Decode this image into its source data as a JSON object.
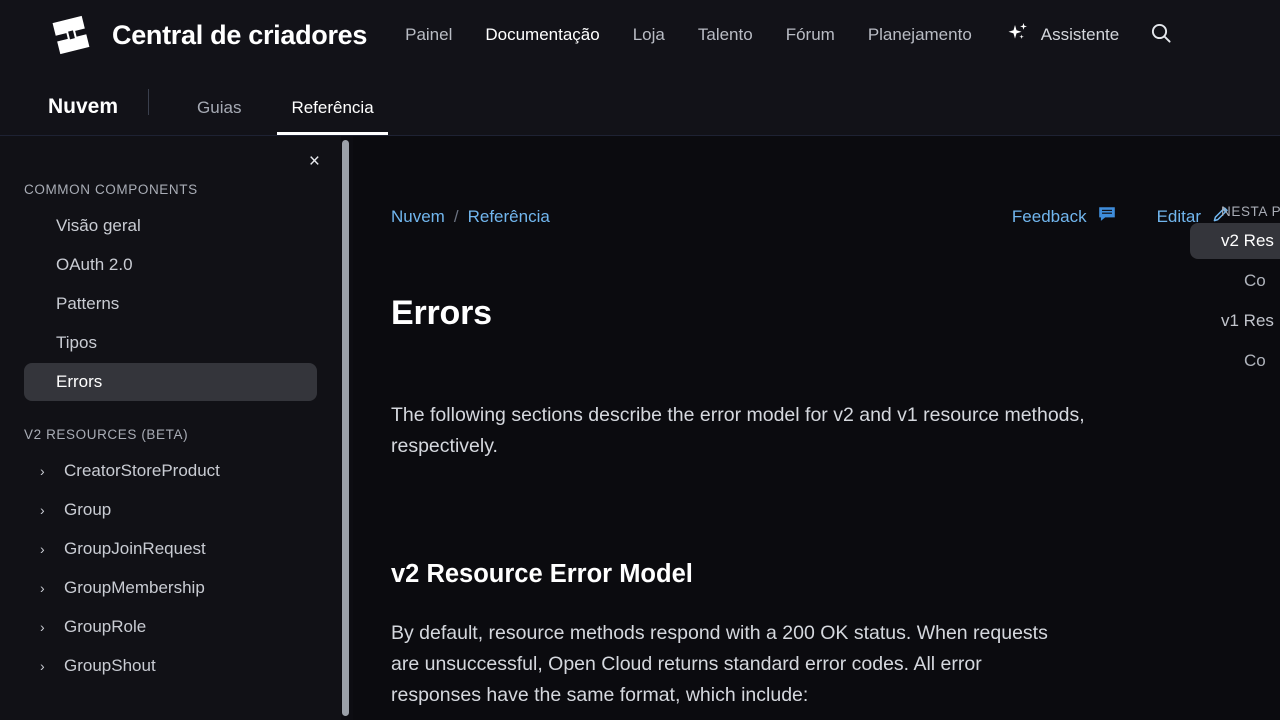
{
  "colors": {
    "page_bg": "#0b0b0f",
    "header_bg": "#121218",
    "sidebar_bg": "#111116",
    "active_pill": "#34353b",
    "link_blue": "#71b6ee",
    "body_text": "#d5d8de"
  },
  "header": {
    "logo_icon": "roblox-logo-icon",
    "brand_title": "Central de criadores",
    "nav": [
      {
        "label": "Painel",
        "active": false
      },
      {
        "label": "Documentação",
        "active": true
      },
      {
        "label": "Loja",
        "active": false
      },
      {
        "label": "Talento",
        "active": false
      },
      {
        "label": "Fórum",
        "active": false
      },
      {
        "label": "Planejamento",
        "active": false
      }
    ],
    "assistant_label": "Assistente",
    "assistant_icon": "sparkles-icon",
    "search_icon": "search-icon"
  },
  "tabbar": {
    "product": "Nuvem",
    "tabs": [
      {
        "label": "Guias",
        "active": false
      },
      {
        "label": "Referência",
        "active": true
      }
    ]
  },
  "sidebar": {
    "close_icon": "close-icon",
    "close_label": "×",
    "sections": [
      {
        "title": "COMMON COMPONENTS",
        "items": [
          {
            "label": "Visão geral",
            "active": false,
            "tree": false
          },
          {
            "label": "OAuth 2.0",
            "active": false,
            "tree": false
          },
          {
            "label": "Patterns",
            "active": false,
            "tree": false
          },
          {
            "label": "Tipos",
            "active": false,
            "tree": false
          },
          {
            "label": "Errors",
            "active": true,
            "tree": false
          }
        ]
      },
      {
        "title": "V2 RESOURCES (BETA)",
        "items": [
          {
            "label": "CreatorStoreProduct",
            "active": false,
            "tree": true
          },
          {
            "label": "Group",
            "active": false,
            "tree": true
          },
          {
            "label": "GroupJoinRequest",
            "active": false,
            "tree": true
          },
          {
            "label": "GroupMembership",
            "active": false,
            "tree": true
          },
          {
            "label": "GroupRole",
            "active": false,
            "tree": true
          },
          {
            "label": "GroupShout",
            "active": false,
            "tree": true
          }
        ]
      }
    ],
    "chevron_icon": "chevron-right-icon"
  },
  "main": {
    "breadcrumb": [
      {
        "label": "Nuvem"
      },
      {
        "label": "Referência"
      }
    ],
    "breadcrumb_separator": "/",
    "feedback_label": "Feedback",
    "feedback_icon": "comment-icon",
    "edit_label": "Editar",
    "edit_icon": "pencil-icon",
    "page_title": "Errors",
    "lede": "The following sections describe the error model for v2 and v1 resource methods, respectively.",
    "section_title": "v2 Resource Error Model",
    "section_body": "By default, resource methods respond with a 200 OK status. When requests are unsuccessful, Open Cloud returns standard error codes. All error responses have the same format, which include:"
  },
  "toc": {
    "heading": "NESTA P",
    "items": [
      {
        "label": "v2 Res",
        "active": true,
        "sub": false
      },
      {
        "label": "Co",
        "active": false,
        "sub": true
      },
      {
        "label": "v1 Res",
        "active": false,
        "sub": false
      },
      {
        "label": "Co",
        "active": false,
        "sub": true
      }
    ]
  }
}
